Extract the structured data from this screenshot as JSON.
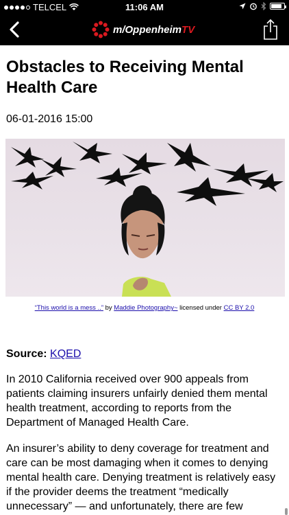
{
  "status_bar": {
    "carrier": "TELCEL",
    "time": "11:06 AM",
    "battery_level": 0.85
  },
  "nav": {
    "logo_prefix": "m",
    "logo_text": "Oppenheim",
    "logo_suffix": "TV",
    "back_icon": "chevron-left-icon",
    "share_icon": "share-icon",
    "accent_color": "#d9191f"
  },
  "article": {
    "title": "Obstacles to Receiving Mental Health Care",
    "date": "06-01-2016 15:00",
    "image": {
      "caption_link1": "“This world is a mess ..”",
      "caption_by": " by ",
      "caption_link2": "Maddie Photography~",
      "caption_licensed": " licensed under ",
      "caption_link3": "CC BY 2.0"
    },
    "source_label": "Source:",
    "source_link": "KQED",
    "paragraphs": [
      "In 2010 California received over 900 appeals from patients claiming insurers unfairly denied them mental health treatment, according to reports from the Department of Managed Health Care.",
      "An insurer’s ability to deny coverage for treatment and care can be most damaging when it comes to denying mental health care. Denying treatment is relatively easy if the provider deems the treatment “medically unnecessary” — and unfortunately, there are few concrete indicators to show that a mental health problem"
    ]
  }
}
